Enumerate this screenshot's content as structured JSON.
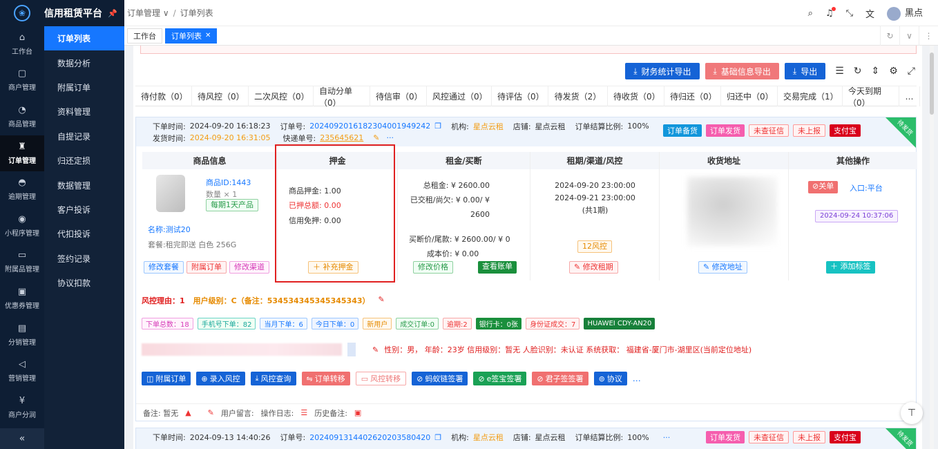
{
  "app": {
    "title": "信用租赁平台"
  },
  "rail": {
    "items": [
      {
        "label": "工作台",
        "icon": "home-icon",
        "glyph": "⌂"
      },
      {
        "label": "商户管理",
        "icon": "shop-icon",
        "glyph": "▢"
      },
      {
        "label": "商品管理",
        "icon": "apple-icon",
        "glyph": "◔"
      },
      {
        "label": "订单管理",
        "icon": "trophy-icon",
        "glyph": "♜"
      },
      {
        "label": "逾期管理",
        "icon": "alarm-icon",
        "glyph": "◓"
      },
      {
        "label": "小程序管理",
        "icon": "watch-icon",
        "glyph": "◉"
      },
      {
        "label": "附属品管理",
        "icon": "truck-icon",
        "glyph": "▭"
      },
      {
        "label": "优惠券管理",
        "icon": "gift-icon",
        "glyph": "▣"
      },
      {
        "label": "分销管理",
        "icon": "chart-icon",
        "glyph": "▤"
      },
      {
        "label": "营销管理",
        "icon": "megaphone-icon",
        "glyph": "◁"
      },
      {
        "label": "商户分润",
        "icon": "coin-icon",
        "glyph": "¥"
      }
    ],
    "collapse": "«"
  },
  "submenu": {
    "items": [
      "订单列表",
      "数据分析",
      "附属订单",
      "资料管理",
      "自提记录",
      "归还定损",
      "数据管理",
      "客户投诉",
      "代扣投诉",
      "签约记录",
      "协议扣款"
    ]
  },
  "topbar": {
    "breadcrumb1": "订单管理",
    "breadcrumb2": "订单列表",
    "user": "黑点"
  },
  "tabs": {
    "items": [
      "工作台",
      "订单列表"
    ]
  },
  "toolbar": {
    "finance": "财务统计导出",
    "basic": "基础信息导出",
    "export": "导出"
  },
  "status_tabs": [
    "待付款（0）",
    "待风控（0）",
    "二次风控（0）",
    "自动分单（0）",
    "待信审（0）",
    "风控通过（0）",
    "待评估（0）",
    "待发货（2）",
    "待收货（0）",
    "待归还（0）",
    "归还中（0）",
    "交易完成（1）",
    "今天到期（0）",
    "…"
  ],
  "order1": {
    "order_time_label": "下单时间:",
    "order_time": "2024-09-20 16:18:23",
    "order_no_label": "订单号:",
    "order_no": "20240920161823040019492​42",
    "org_label": "机构:",
    "org": "星点云租",
    "store_label": "店铺:",
    "store": "星点云租",
    "ratio_label": "订单结算比例:",
    "ratio": "100%",
    "ship_time_label": "发货时间:",
    "ship_time": "2024-09-20 16:31:05",
    "express_label": "快递单号:",
    "express": "235645621",
    "badges": [
      "订单备货",
      "订单发货",
      "未查征信",
      "未上报",
      "支付宝"
    ],
    "corner": "待发货",
    "col_heads": [
      "商品信息",
      "押金",
      "租金/买断",
      "租期/渠道/风控",
      "收货地址",
      "其他操作"
    ],
    "product": {
      "id_label": "商品ID:",
      "id": "1443",
      "qty": "数量 × 1",
      "tag": "每期1天产品",
      "name_label": "名称:",
      "name": "测试20",
      "spec_label": "套餐:",
      "spec": "租完即送 白色 256G",
      "btns": [
        "修改套餐",
        "附属订单",
        "修改渠道"
      ]
    },
    "deposit": {
      "l1": "商品押金:",
      "v1": "1.00",
      "l2": "已押总额:",
      "v2": "0.00",
      "l3": "信用免押:",
      "v3": "0.00",
      "btn": "补充押金"
    },
    "rent": {
      "l1": "总租金:",
      "v1": "¥ 2600.00",
      "l2": "已交租/尚欠:",
      "v2": "¥ 0.00/ ¥ 2600",
      "l3": "买断价/尾款:",
      "v3": "¥ 2600.00/ ¥ 0",
      "l4": "成本价:",
      "v4": "¥ 0.00",
      "btn1": "修改价格",
      "btn2": "查看账单"
    },
    "period": {
      "d1": "2024-09-20 23:00:00",
      "d2": "2024-09-21 23:00:00",
      "d3": "(共1期)",
      "risk": "12风控",
      "btn": "修改租期"
    },
    "address": {
      "btn": "修改地址"
    },
    "other": {
      "close": "关单",
      "entry": "入口:平台",
      "date": "2024-09-24 10:37:06",
      "btn": "添加标签"
    },
    "risk_reason": "风控理由：1",
    "user_level": "用户级别：C（备注：534534345345345343）",
    "counts": [
      "下单总数：18",
      "手机号下单：82",
      "当月下单：6",
      "今日下单：0",
      "新用户",
      "成交订单:0",
      "逾期:2",
      "银行卡：0张",
      "身份证成交：7",
      "HUAWEI CDY-AN20"
    ],
    "info": "性别：男，  年龄：23岁   信用级别：暂无   人脸识别：未认证         系统获取：   福建省-厦门市-湖里区(当前定位地址)",
    "actions": [
      "附属订单",
      "录入风控",
      "风控查询",
      "订单转移",
      "风控转移",
      "蚂蚁链签署",
      "e签宝签署",
      "君子签签署",
      "协议",
      "…"
    ],
    "remark": {
      "note": "备注: 暂无",
      "leave": "用户留言:",
      "log": "操作日志:",
      "history": "历史备注:"
    }
  },
  "order2": {
    "order_time": "2024-09-13 14:40:26",
    "order_no": "20240913144026202035804​20",
    "org": "星点云租",
    "store": "星点云租",
    "ratio": "100%",
    "badges": [
      "订单发货",
      "未查征信",
      "未上报",
      "支付宝"
    ],
    "corner": "待发货"
  }
}
